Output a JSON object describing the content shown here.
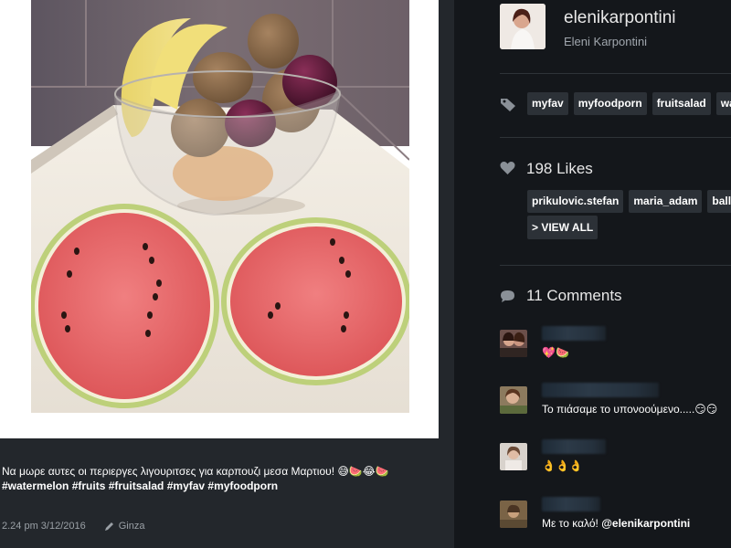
{
  "post": {
    "caption": "Να μωρε αυτες οι περιεργες λιγουριτσες για καρπουζι μεσα Μαρτιου! 😅🍉😂🍉",
    "hashtags": "#watermelon #fruits #fruitsalad #myfav #myfoodporn",
    "timestamp": "2.24 pm 3/12/2016",
    "location": "Ginza"
  },
  "profile": {
    "username": "elenikarpontini",
    "full_name": "Eleni Karpontini"
  },
  "tags": [
    "myfav",
    "myfoodporn",
    "fruitsalad",
    "watermelon"
  ],
  "likes": {
    "label": "198 Likes",
    "users": [
      "prikulovic.stefan",
      "maria_adam",
      "ballin"
    ],
    "view_all_label": "> VIEW ALL"
  },
  "comments": {
    "label": "11 Comments",
    "items": [
      {
        "text": "💖🍉"
      },
      {
        "text": "Το πιάσαμε το υπονοούμενο.....😏😏"
      },
      {
        "text": "👌👌👌"
      },
      {
        "text": "Με το καλό! ",
        "mention": "@elenikarpontini"
      }
    ]
  },
  "icons": {
    "tag": "tag-icon",
    "likes": "heart-icon",
    "comments": "speech-bubble-icon",
    "location": "pencil-icon"
  },
  "colors": {
    "page_bg": "#14171b",
    "left_bg": "#23272c",
    "chip_bg": "#2c3137",
    "watermelon_flesh": "#e8686c"
  }
}
